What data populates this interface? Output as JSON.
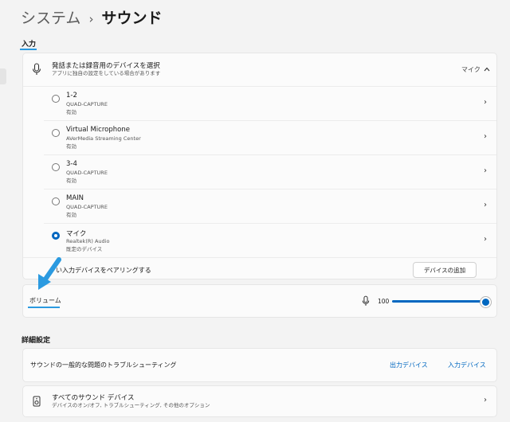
{
  "header": {
    "breadcrumb_root": "システム",
    "breadcrumb_sep": "›",
    "breadcrumb_current": "サウンド"
  },
  "input_section": {
    "title": "入力",
    "select_card": {
      "title": "発話または録音用のデバイスを選択",
      "subtitle": "アプリに独自の設定をしている場合があります",
      "current_value": "マイク",
      "icon": "microphone-icon",
      "expand_icon": "chevron-up-icon"
    },
    "devices": [
      {
        "name": "1-2",
        "source": "QUAD-CAPTURE",
        "status": "有効",
        "selected": false
      },
      {
        "name": "Virtual Microphone",
        "source": "AVerMedia Streaming Center",
        "status": "有効",
        "selected": false
      },
      {
        "name": "3-4",
        "source": "QUAD-CAPTURE",
        "status": "有効",
        "selected": false
      },
      {
        "name": "MAIN",
        "source": "QUAD-CAPTURE",
        "status": "有効",
        "selected": false
      },
      {
        "name": "マイク",
        "source": "Realtek(R) Audio",
        "status": "既定のデバイス",
        "selected": true
      }
    ],
    "pair_row": {
      "text": "い入力デバイスをペアリングする",
      "button": "デバイスの追加"
    },
    "volume": {
      "label": "ボリューム",
      "value": "100",
      "level_percent": 100,
      "icon": "microphone-icon"
    }
  },
  "advanced_section": {
    "title": "詳細設定",
    "troubleshoot": {
      "text": "サウンドの一般的な問題のトラブルシューティング",
      "link_output": "出力デバイス",
      "link_input": "入力デバイス"
    },
    "all_devices": {
      "title": "すべてのサウンド デバイス",
      "subtitle": "デバイスのオン/オフ, トラブルシューティング, その他のオプション",
      "icon": "speaker-icon"
    }
  },
  "annotation": {
    "arrow_color": "#2b9ae0",
    "underline_color": "#2b9ae0"
  },
  "colors": {
    "accent": "#0067c0",
    "background": "#f3f3f3",
    "card": "#fbfbfb"
  }
}
